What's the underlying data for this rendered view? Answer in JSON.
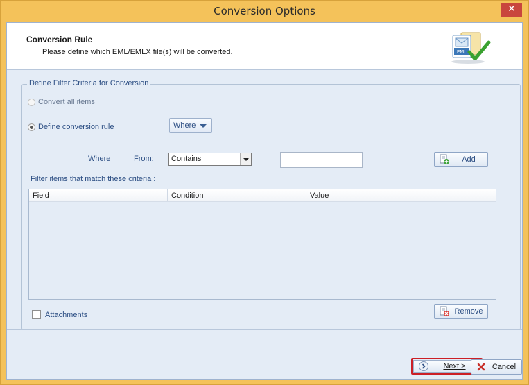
{
  "window": {
    "title": "Conversion Options",
    "close_glyph": "✕"
  },
  "header": {
    "title": "Conversion Rule",
    "description": "Please define which EML/EMLX file(s) will be converted.",
    "icon_label": "EML"
  },
  "filter": {
    "group_title": "Define Filter Criteria for Conversion",
    "options": [
      {
        "label": "Convert all items",
        "checked": false
      },
      {
        "label": "Define conversion rule",
        "checked": true
      }
    ],
    "where_dropdown": "Where",
    "where_label": "Where",
    "from_label": "From:",
    "condition_value": "Contains",
    "value_input": "",
    "add_button": "Add",
    "match_label": "Filter items that match these criteria :",
    "table": {
      "columns": [
        "Field",
        "Condition",
        "Value"
      ],
      "rows": []
    },
    "attachments_label": "Attachments",
    "attachments_checked": false,
    "remove_button": "Remove"
  },
  "footer": {
    "next_button": "Next >",
    "cancel_button": "Cancel"
  },
  "colors": {
    "window_frame": "#f4c25a",
    "close_button": "#c9463d",
    "label_blue": "#2d4f84",
    "next_highlight": "#cc1f26"
  }
}
